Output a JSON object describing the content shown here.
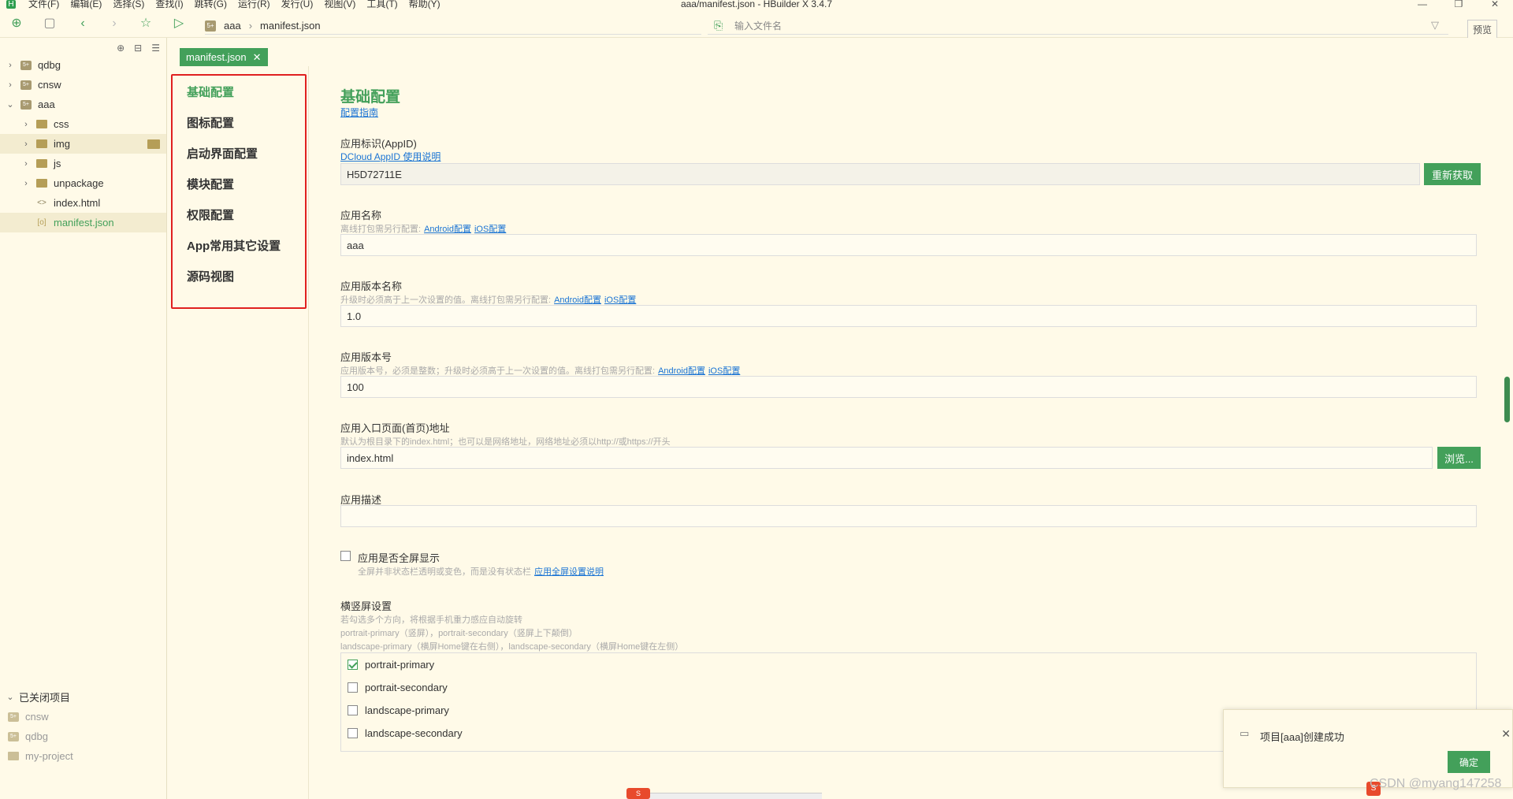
{
  "app": {
    "logo": "H",
    "window_title": "aaa/manifest.json - HBuilder X 3.4.7",
    "menus": [
      "文件(F)",
      "编辑(E)",
      "选择(S)",
      "查找(I)",
      "跳转(G)",
      "运行(R)",
      "发行(U)",
      "视图(V)",
      "工具(T)",
      "帮助(Y)"
    ],
    "window_controls": [
      "—",
      "❐",
      "✕"
    ]
  },
  "toolbar": {
    "breadcrumb": [
      "aaa",
      "manifest.json"
    ],
    "search_placeholder": "输入文件名",
    "preview_label": "预览"
  },
  "sidebar": {
    "projects": [
      {
        "label": "qdbg",
        "expanded": false
      },
      {
        "label": "cnsw",
        "expanded": false
      },
      {
        "label": "aaa",
        "expanded": true
      }
    ],
    "aaa_children": [
      {
        "label": "css",
        "type": "folder"
      },
      {
        "label": "img",
        "type": "folder"
      },
      {
        "label": "js",
        "type": "folder"
      },
      {
        "label": "unpackage",
        "type": "folder"
      },
      {
        "label": "index.html",
        "type": "html"
      },
      {
        "label": "manifest.json",
        "type": "json"
      }
    ],
    "closed_title": "已关闭项目",
    "closed_projects": [
      "cnsw",
      "qdbg",
      "my-project"
    ]
  },
  "tab": {
    "label": "manifest.json",
    "close": "✕"
  },
  "nav": {
    "items": [
      "基础配置",
      "图标配置",
      "启动界面配置",
      "模块配置",
      "权限配置",
      "App常用其它设置",
      "源码视图"
    ],
    "active_index": 0
  },
  "form": {
    "section_title": "基础配置",
    "guide_link": "配置指南",
    "appid": {
      "label": "应用标识(AppID)",
      "link": "DCloud AppID 使用说明",
      "value": "H5D72711E",
      "button": "重新获取"
    },
    "name": {
      "label": "应用名称",
      "hint": "离线打包需另行配置:",
      "link_android": "Android配置",
      "link_ios": "iOS配置",
      "value": "aaa"
    },
    "version_name": {
      "label": "应用版本名称",
      "hint": "升级时必须高于上一次设置的值。离线打包需另行配置:",
      "link_android": "Android配置",
      "link_ios": "iOS配置",
      "value": "1.0"
    },
    "version_code": {
      "label": "应用版本号",
      "hint": "应用版本号，必须是整数；升级时必须高于上一次设置的值。离线打包需另行配置:",
      "link_android": "Android配置",
      "link_ios": "iOS配置",
      "value": "100"
    },
    "entry": {
      "label": "应用入口页面(首页)地址",
      "hint": "默认为根目录下的index.html；也可以是网络地址，网络地址必须以http://或https://开头",
      "value": "index.html",
      "button": "浏览..."
    },
    "description": {
      "label": "应用描述",
      "value": ""
    },
    "fullscreen": {
      "label": "应用是否全屏显示",
      "hint": "全屏并非状态栏透明或变色，而是没有状态栏",
      "link": "应用全屏设置说明",
      "checked": false
    },
    "orientation": {
      "label": "横竖屏设置",
      "hint1": "若勾选多个方向，将根据手机重力感应自动旋转",
      "hint2": "portrait-primary（竖屏），portrait-secondary（竖屏上下颠倒）",
      "hint3": "landscape-primary（横屏Home键在右侧），landscape-secondary（横屏Home键在左侧）",
      "options": [
        {
          "label": "portrait-primary",
          "checked": true
        },
        {
          "label": "portrait-secondary",
          "checked": false
        },
        {
          "label": "landscape-primary",
          "checked": false
        },
        {
          "label": "landscape-secondary",
          "checked": false
        }
      ]
    }
  },
  "toast": {
    "message": "项目[aaa]创建成功",
    "ok": "确定",
    "close": "✕"
  },
  "watermark": "CSDN @myang147258"
}
